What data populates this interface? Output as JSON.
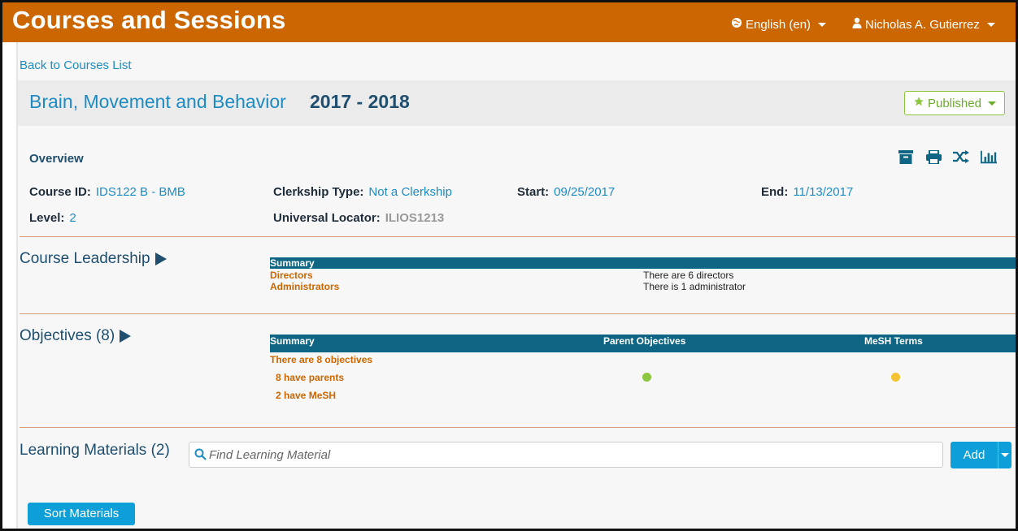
{
  "header": {
    "app_title": "Courses and Sessions",
    "language": "English (en)",
    "user": "Nicholas A. Gutierrez"
  },
  "nav": {
    "back_link": "Back to Courses List"
  },
  "course": {
    "name": "Brain, Movement and Behavior",
    "year": "2017 - 2018",
    "status": "Published"
  },
  "overview": {
    "label": "Overview",
    "course_id_label": "Course ID:",
    "course_id": "IDS122 B - BMB",
    "clerkship_label": "Clerkship Type:",
    "clerkship": "Not a Clerkship",
    "start_label": "Start:",
    "start": "09/25/2017",
    "end_label": "End:",
    "end": "11/13/2017",
    "level_label": "Level:",
    "level": "2",
    "locator_label": "Universal Locator:",
    "locator": "ILIOS1213"
  },
  "leadership": {
    "title": "Course Leadership",
    "summary_header": "Summary",
    "rows": [
      {
        "label": "Directors",
        "value": "There are 6 directors"
      },
      {
        "label": "Administrators",
        "value": "There is 1 administrator"
      }
    ]
  },
  "objectives": {
    "title": "Objectives (8)",
    "headers": [
      "Summary",
      "Parent Objectives",
      "MeSH Terms"
    ],
    "count_text": "There are 8 objectives",
    "parents_text": "8 have parents",
    "mesh_text": "2 have MeSH",
    "parent_status_color": "#8dc63f",
    "mesh_status_color": "#f5c332"
  },
  "learning_materials": {
    "title": "Learning Materials (2)",
    "search_placeholder": "Find Learning Material",
    "add_label": "Add",
    "sort_label": "Sort Materials"
  },
  "colors": {
    "header_bg": "#cc6600",
    "link": "#1e8bc3",
    "table_header": "#0f6684",
    "accent_orange": "#cc6600",
    "button": "#0e9fd8",
    "published": "#6aab2a"
  }
}
